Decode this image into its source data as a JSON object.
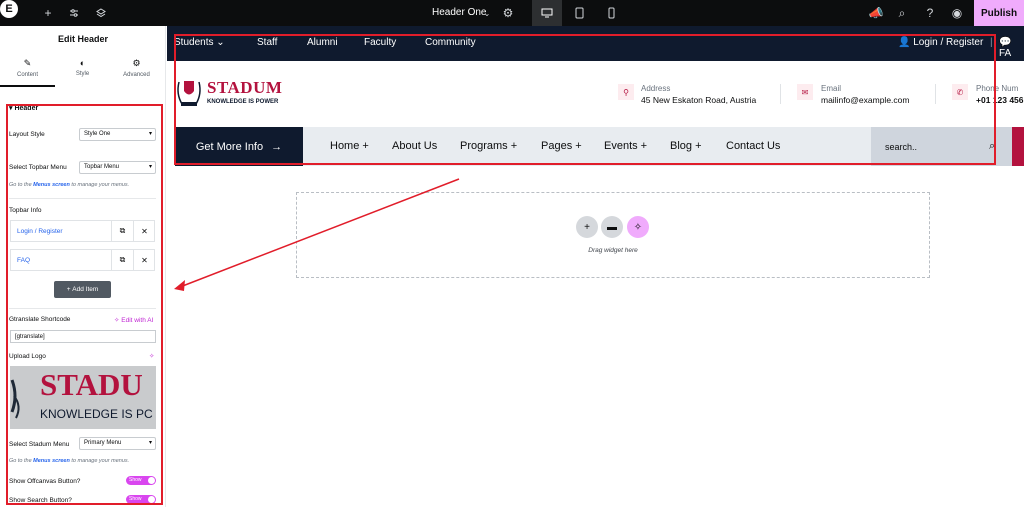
{
  "toolbar": {
    "logo": "E",
    "doc_title": "Header One",
    "publish": "Publish",
    "icons": [
      "add-icon",
      "settings-sliders-icon",
      "layers-icon",
      "site-settings-icon",
      "desktop-icon",
      "tablet-icon",
      "mobile-icon",
      "notifications-icon",
      "search-icon",
      "help-icon",
      "preview-eye-icon"
    ]
  },
  "panel": {
    "title": "Edit Header",
    "tabs": [
      {
        "label": "Content",
        "icon": "pencil-icon"
      },
      {
        "label": "Style",
        "icon": "contrast-icon"
      },
      {
        "label": "Advanced",
        "icon": "gear-icon"
      }
    ],
    "section_title": "Header",
    "layout_style": {
      "label": "Layout Style",
      "value": "Style One"
    },
    "topbar_menu": {
      "label": "Select Topbar Menu",
      "value": "Topbar Menu"
    },
    "hint_prefix": "Go to the",
    "hint_link": "Menus screen",
    "hint_suffix": "to manage your menus.",
    "topbar_info_label": "Topbar Info",
    "topbar_info_items": [
      "Login / Register",
      "FAQ"
    ],
    "add_item": "Add Item",
    "gtranslate_label": "Gtranslate Shortcode",
    "edit_with_ai": "Edit with AI",
    "gtranslate_value": "[gtranslate]",
    "upload_logo_label": "Upload Logo",
    "logo_preview_name": "STADU",
    "logo_preview_tag": "KNOWLEDGE IS PC",
    "stadum_menu": {
      "label": "Select Stadum Menu",
      "value": "Primary Menu"
    },
    "offcanvas": {
      "label": "Show Offcanvas Button?",
      "value": "Show"
    },
    "search_btn": {
      "label": "Show Search Button?",
      "value": "Show"
    }
  },
  "site": {
    "topbar_left": [
      "Students",
      "Staff",
      "Alumni",
      "Faculty",
      "Community"
    ],
    "login": "Login / Register",
    "faq_short": "FA",
    "brand_name": "STADUM",
    "brand_tag": "KNOWLEDGE IS POWER",
    "info": [
      {
        "label": "Address",
        "value": "45 New Eskaton Road, Austria",
        "icon": "map-pin-icon"
      },
      {
        "label": "Email",
        "value": "mailinfo@example.com",
        "icon": "mail-icon"
      },
      {
        "label": "Phone Num",
        "value": "+01 123 456",
        "icon": "phone-icon"
      }
    ],
    "get_info": "Get More Info",
    "menu": [
      "Home +",
      "About Us",
      "Programs +",
      "Pages +",
      "Events +",
      "Blog +",
      "Contact Us"
    ],
    "search_placeholder": "search..",
    "drag_text": "Drag widget here"
  },
  "colors": {
    "brand": "#b3123e",
    "navy": "#0f1a2e",
    "publish": "#f0abfc",
    "annotation": "#e11d2a"
  }
}
